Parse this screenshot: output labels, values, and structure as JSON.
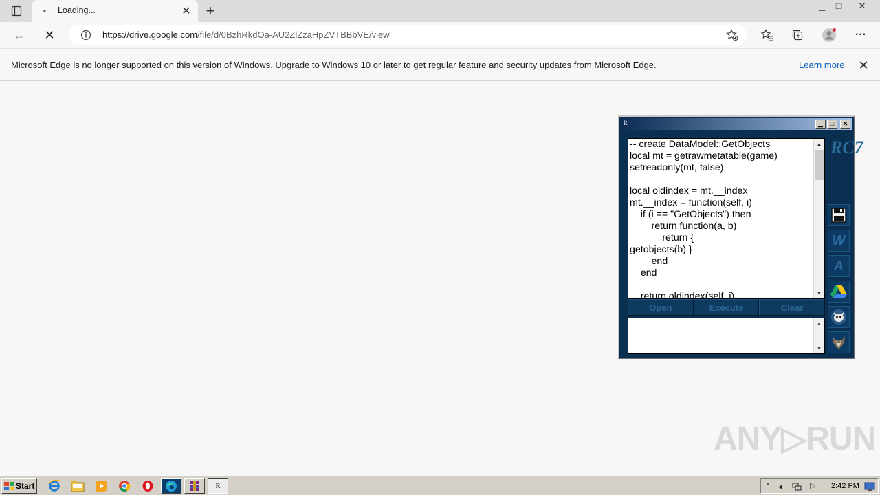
{
  "browser": {
    "tab": {
      "title": "Loading...",
      "favicon": "•"
    },
    "address": {
      "host": "https://drive.google.com",
      "path": "/file/d/0BzhRkdOa-AU2ZlZzaHpZVTBBbVE/view"
    }
  },
  "infobar": {
    "message": "Microsoft Edge is no longer supported on this version of Windows. Upgrade to Windows 10 or later to get regular feature and security updates from Microsoft Edge.",
    "link": "Learn more"
  },
  "rc7": {
    "title_icon": "R",
    "logo": "RC7",
    "code": "-- create DataModel::GetObjects\nlocal mt = getrawmetatable(game)\nsetreadonly(mt, false)\n\nlocal oldindex = mt.__index\nmt.__index = function(self, i)\n\tif (i == \"GetObjects\") then\n\t\treturn function(a, b)\n\t\t\treturn {\ngetobjects(b) }\n\t\tend\n\tend\n\n\treturn oldindex(self, i)",
    "buttons": {
      "open": "Open",
      "execute": "Execute",
      "clear": "Clear"
    },
    "side": {
      "w": "W",
      "a": "A"
    }
  },
  "watermark": "ANY▷RUN",
  "taskbar": {
    "start": "Start",
    "clock": "2:42 PM",
    "task_label": "R"
  }
}
